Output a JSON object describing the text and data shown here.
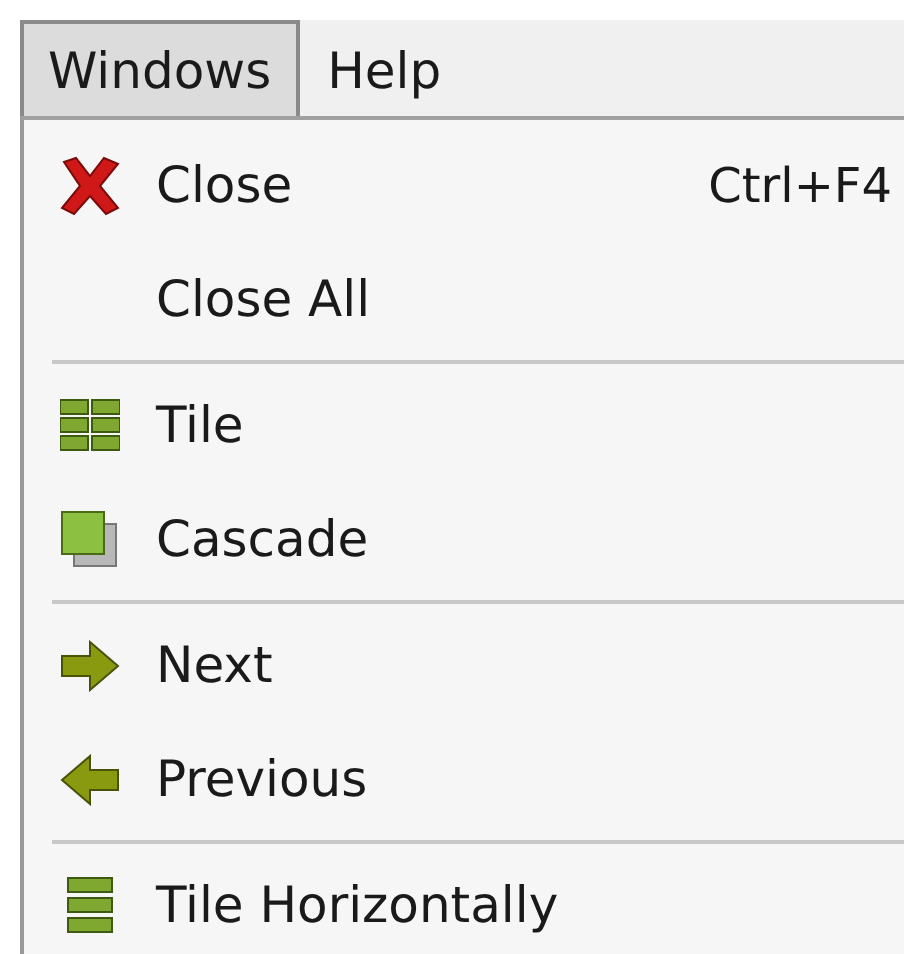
{
  "menubar": [
    {
      "label": "Windows",
      "selected": true
    },
    {
      "label": "Help",
      "selected": false
    }
  ],
  "menu": [
    {
      "kind": "item",
      "label": "Close",
      "shortcut": "Ctrl+F4"
    },
    {
      "kind": "item",
      "label": "Close All"
    },
    {
      "kind": "separator"
    },
    {
      "kind": "item",
      "label": "Tile"
    },
    {
      "kind": "item",
      "label": "Cascade"
    },
    {
      "kind": "separator"
    },
    {
      "kind": "item",
      "label": "Next"
    },
    {
      "kind": "item",
      "label": "Previous"
    },
    {
      "kind": "separator"
    },
    {
      "kind": "item",
      "label": "Tile Horizontally"
    }
  ]
}
